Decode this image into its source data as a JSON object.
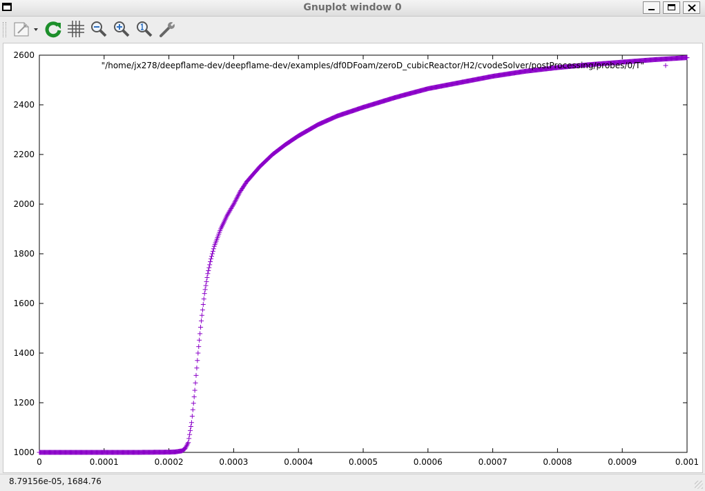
{
  "window": {
    "title": "Gnuplot window 0"
  },
  "toolbar": {
    "buttons": [
      {
        "name": "export-button",
        "icon": "export-document-icon"
      },
      {
        "name": "replot-button",
        "icon": "replot-icon"
      },
      {
        "name": "grid-button",
        "icon": "grid-icon"
      },
      {
        "name": "zoom-previous-button",
        "icon": "zoom-out-icon"
      },
      {
        "name": "zoom-next-button",
        "icon": "zoom-in-icon"
      },
      {
        "name": "unzoom-button",
        "icon": "zoom-reset-icon"
      },
      {
        "name": "options-button",
        "icon": "wrench-icon"
      }
    ]
  },
  "status": {
    "coordinates": "8.79156e-05,  1684.76"
  },
  "colors": {
    "series": "#8a00c8",
    "axis": "#000000",
    "background": "#ffffff"
  },
  "chart_data": {
    "type": "scatter",
    "title": "",
    "xlabel": "",
    "ylabel": "",
    "xlim": [
      0,
      0.001
    ],
    "ylim": [
      1000,
      2600
    ],
    "x_ticks": [
      "0",
      "0.0001",
      "0.0002",
      "0.0003",
      "0.0004",
      "0.0005",
      "0.0006",
      "0.0007",
      "0.0008",
      "0.0009",
      "0.001"
    ],
    "y_ticks": [
      "1000",
      "1200",
      "1400",
      "1600",
      "1800",
      "2000",
      "2200",
      "2400",
      "2600"
    ],
    "grid": false,
    "legend_position": "top-right",
    "marker": "+",
    "series": [
      {
        "name": "\"/home/jx278/deepflame-dev/deepflame-dev/examples/df0DFoam/zeroD_cubicReactor/H2/cvodeSolver/postProcessing/probes/0/T\"",
        "x": [
          0,
          5e-05,
          0.0001,
          0.00015,
          0.0002,
          0.00021,
          0.00022,
          0.000225,
          0.00023,
          0.000235,
          0.00024,
          0.000245,
          0.00025,
          0.000255,
          0.00026,
          0.000265,
          0.00027,
          0.00028,
          0.00029,
          0.0003,
          0.00031,
          0.00032,
          0.00034,
          0.00036,
          0.00038,
          0.0004,
          0.00043,
          0.00046,
          0.0005,
          0.00055,
          0.0006,
          0.00065,
          0.0007,
          0.00075,
          0.0008,
          0.00085,
          0.0009,
          0.00095,
          0.001
        ],
        "y": [
          1000,
          1000,
          1000,
          1000,
          1001,
          1002,
          1006,
          1015,
          1040,
          1120,
          1250,
          1400,
          1530,
          1640,
          1720,
          1780,
          1830,
          1900,
          1955,
          2000,
          2050,
          2090,
          2150,
          2200,
          2240,
          2275,
          2320,
          2355,
          2390,
          2430,
          2465,
          2490,
          2515,
          2535,
          2550,
          2562,
          2572,
          2582,
          2590
        ]
      }
    ]
  }
}
